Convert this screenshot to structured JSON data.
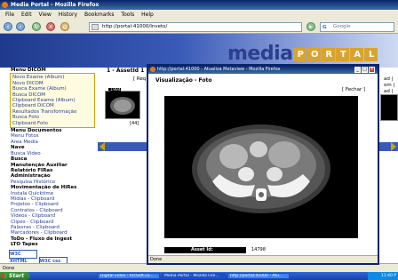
{
  "window": {
    "title": "Media Portal - Mozilla Firefox"
  },
  "menu": [
    "File",
    "Edit",
    "View",
    "History",
    "Bookmarks",
    "Tools",
    "Help"
  ],
  "nav": {
    "url": "http://portal:41000/Inveto/",
    "search_placeholder": "Google"
  },
  "logo": {
    "left": "media",
    "right": [
      "P",
      "O",
      "R",
      "T",
      "A",
      "L"
    ]
  },
  "sidebar": {
    "dicom_header": "Menu DICOM",
    "dicom_items": [
      "Novo Exame (Album)",
      "Novo DICOM",
      "Busca Exame (Album)",
      "Busca DICOM",
      "Clipboard Exame (Album)",
      "Clipboard DICOM",
      "Resultados Transformação",
      "Busca Foto",
      "Clipboard Foto"
    ],
    "sections": [
      {
        "header": "Menu Documentos",
        "items": [
          "Menu Fotos",
          "Area Media"
        ]
      },
      {
        "header": "Nave",
        "items": [
          "Busca Video"
        ]
      },
      {
        "header": "Busca",
        "items": []
      },
      {
        "header": "Manutenção Auxiliar",
        "items": []
      },
      {
        "header": "Relatório FIRas",
        "items": []
      },
      {
        "header": "Administração",
        "items": [
          "Pesquisa Histórico"
        ]
      },
      {
        "header": "Movimentação de HiRes",
        "items": [
          "Instala Quicktime",
          "Mídias - Clipboard",
          "Projetos - Clipboard",
          "Contratos - Clipboard",
          "Vídeos - Clipboard",
          "Clipes - Clipboard",
          "Palavras - Clipboard",
          "Marcadores - Clipboard"
        ]
      },
      {
        "header": "ToDo - Fluxo de Ingest",
        "items": []
      },
      {
        "header": "LTO Tapes",
        "items": []
      }
    ]
  },
  "content": {
    "title": "1 - AssetId 1",
    "req_label": "[ Req",
    "thumb_label": "_1984",
    "thumb_id": "[44]",
    "right_frag": [
      "ad |",
      "om |",
      "ad |"
    ]
  },
  "popup": {
    "title": "http://portal:41000 - Atualiza Metaview - Mozilla Firefox",
    "heading": "Visualização - Foto",
    "close": "[ Fechar ]",
    "asset_label": "Asset Id:",
    "asset_value": "14798",
    "status": "Done"
  },
  "status": "Done",
  "taskbar": {
    "start": "Start",
    "tasks": [
      "Digital video : ArcSoft.co...",
      "Media Portal - Mozilla Fire...",
      "http://portal:41000 - Atu..."
    ],
    "clock": "11:40 P"
  },
  "colors": {
    "title_bar": "#0a246a",
    "banner": "#1f3a8c",
    "accent_gold": "#d9a32f",
    "link": "#2a3f8f"
  }
}
